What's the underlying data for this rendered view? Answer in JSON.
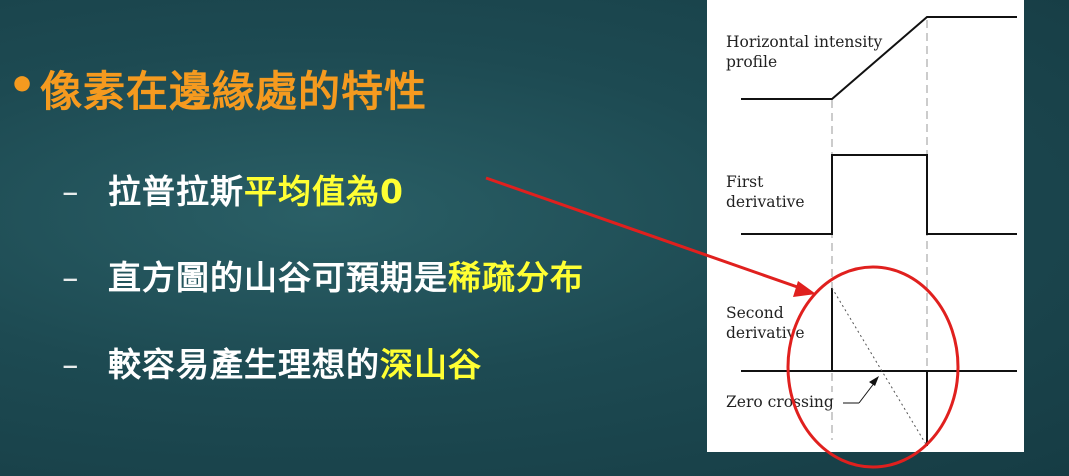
{
  "slide": {
    "bullet": "•",
    "heading": "像素在邊緣處的特性",
    "items": [
      {
        "dash": "–",
        "plain": "拉普拉斯",
        "highlight": "平均值為0"
      },
      {
        "dash": "–",
        "plain": "直方圖的山谷可預期是",
        "highlight": "稀疏分布"
      },
      {
        "dash": "–",
        "plain": "較容易產生理想的",
        "highlight": "深山谷"
      }
    ]
  },
  "figure": {
    "labels": {
      "intensity": "Horizontal intensity\nprofile",
      "first": "First\nderivative",
      "second": "Second\nderivative",
      "zero": "Zero crossing"
    }
  },
  "colors": {
    "background": "#1d4a52",
    "heading": "#f59a1f",
    "highlight": "#ffff33",
    "annotation": "#e0201e"
  }
}
